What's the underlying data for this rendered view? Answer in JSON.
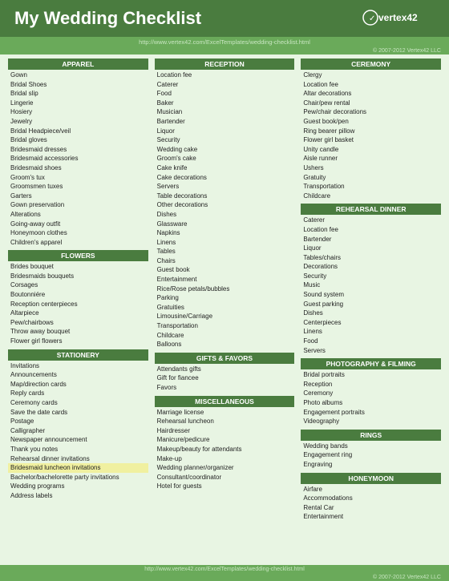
{
  "header": {
    "title": "My Wedding Checklist",
    "logo_line1": "vertex42",
    "url": "http://www.vertex42.com/ExcelTemplates/wedding-checklist.html"
  },
  "copyright": "© 2007-2012 Vertex42 LLC",
  "footer_url": "http://www.vertex42.com/ExcelTemplates/wedding-checklist.html",
  "footer_copy": "© 2007-2012 Vertex42 LLC",
  "columns": [
    {
      "sections": [
        {
          "header": "APPAREL",
          "items": [
            "Gown",
            "Bridal Shoes",
            "Bridal slip",
            "Lingerie",
            "Hosiery",
            "Jewelry",
            "Bridal Headpiece/veil",
            "Bridal gloves",
            "Bridesmaid dresses",
            "Bridesmaid accessories",
            "Bridesmaid shoes",
            "Groom's tux",
            "Groomsmen tuxes",
            "Garters",
            "Gown preservation",
            "Alterations",
            "Going-away outfit",
            "Honeymoon clothes",
            "Children's apparel"
          ]
        },
        {
          "header": "FLOWERS",
          "items": [
            "Brides bouquet",
            "Bridesmaids bouquets",
            "Corsages",
            "Boutonniére",
            "Reception centerpieces",
            "Altarpiece",
            "Pew/chairbows",
            "Throw away bouquet",
            "Flower girl flowers"
          ]
        },
        {
          "header": "STATIONERY",
          "items": [
            "Invitations",
            "Announcements",
            "Map/direction cards",
            "Reply cards",
            "Ceremony cards",
            "Save the date cards",
            "Postage",
            "Calligrapher",
            "Newspaper announcement",
            "Thank you notes",
            "Rehearsal dinner invitations",
            "Bridesmaid luncheon invitations",
            "Bachelor/bachelorette party invitations",
            "Wedding programs",
            "Address labels"
          ],
          "highlight_index": 11
        }
      ]
    },
    {
      "sections": [
        {
          "header": "RECEPTION",
          "items": [
            "Location fee",
            "Caterer",
            "Food",
            "Baker",
            "Musician",
            "Bartender",
            "Liquor",
            "Security",
            "Wedding cake",
            "Groom's cake",
            "Cake knife",
            "Cake decorations",
            "Servers",
            "Table decorations",
            "Other decorations",
            "Dishes",
            "Glassware",
            "Napkins",
            "Linens",
            "Tables",
            "Chairs",
            "Guest book",
            "Entertainment",
            "Rice/Rose petals/bubbles",
            "Parking",
            "Gratuities",
            "Limousine/Carriage",
            "Transportation",
            "Childcare",
            "Balloons"
          ]
        },
        {
          "header": "GIFTS & FAVORS",
          "items": [
            "Attendants gifts",
            "Gift for fiancee",
            "Favors"
          ]
        },
        {
          "header": "MISCELLANEOUS",
          "items": [
            "Marriage license",
            "Rehearsal luncheon",
            "Hairdresser",
            "Manicure/pedicure",
            "Makeup/beauty for attendants",
            "Make-up",
            "Wedding planner/organizer",
            "Consultant/coordinator",
            "Hotel for guests"
          ]
        }
      ]
    },
    {
      "sections": [
        {
          "header": "CEREMONY",
          "items": [
            "Clergy",
            "Location fee",
            "Altar decorations",
            "Chair/pew rental",
            "Pew/chair decorations",
            "Guest book/pen",
            "Ring bearer pillow",
            "Flower girl basket",
            "Unity candle",
            "Aisle runner",
            "Ushers",
            "Gratuity",
            "Transportation",
            "Childcare"
          ]
        },
        {
          "header": "REHEARSAL DINNER",
          "items": [
            "Caterer",
            "Location fee",
            "Bartender",
            "Liquor",
            "Tables/chairs",
            "Decorations",
            "Security",
            "Music",
            "Sound system",
            "Guest parking",
            "Dishes",
            "Centerpieces",
            "Linens",
            "Food",
            "Servers"
          ]
        },
        {
          "header": "PHOTOGRAPHY & FILMING",
          "items": [
            "Bridal portraits",
            "Reception",
            "Ceremony",
            "Photo albums",
            "Engagement portraits",
            "Videography"
          ]
        },
        {
          "header": "RINGS",
          "items": [
            "Wedding bands",
            "Engagement ring",
            "Engraving"
          ]
        },
        {
          "header": "HONEYMOON",
          "items": [
            "Airfare",
            "Accommodations",
            "Rental Car",
            "Entertainment"
          ]
        }
      ]
    }
  ]
}
